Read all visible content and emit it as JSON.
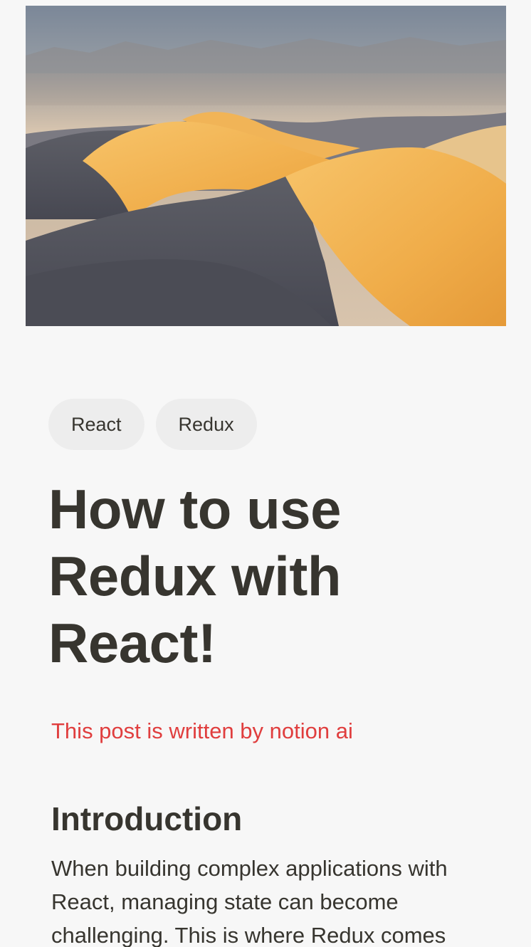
{
  "cover": {
    "image": "desert-sand-dunes-photo"
  },
  "tags": [
    {
      "label": "React"
    },
    {
      "label": "Redux"
    }
  ],
  "post": {
    "title": "How to use Redux with React!",
    "byline": "This post is written by notion ai",
    "byline_color": "#e03e3e",
    "section_heading": "Introduction",
    "section_text": "When building complex applications with React, managing state can become challenging. This is where Redux comes"
  }
}
